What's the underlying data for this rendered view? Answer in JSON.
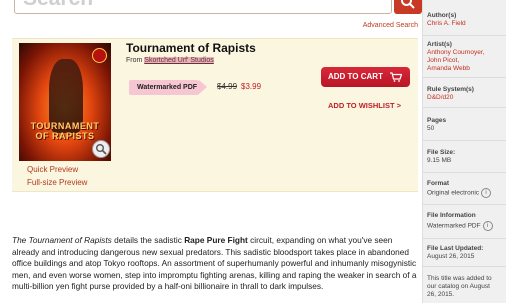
{
  "search": {
    "placeholder": "Search",
    "advanced_link": "Advanced Search"
  },
  "product": {
    "title": "Tournament of Rapists",
    "from_label": "From",
    "publisher": "Skortched Urf' Studios",
    "cover_title": "TOURNAMENT OF RAPISTS",
    "format_badge": "Watermarked PDF",
    "old_price": "$4.99",
    "price": "$3.99",
    "add_to_cart": "ADD TO CART",
    "add_to_wishlist": "ADD TO WISHLIST >",
    "quick_preview": "Quick Preview",
    "fullsize_preview": "Full-size Preview"
  },
  "description": {
    "title_italic": "The Tournament of Rapists",
    "text1": " details the sadistic ",
    "bold": "Rape Pure Fight",
    "text2": " circuit, expanding on what you've seen already and introducing dangerous new sexual predators. This sadistic bloodsport takes place in abandoned office buildings and atop Tokyo rooftops. An assortment of superhumanly powerful and inhumanly misogynistic men, and even worse women, step into impromptu fighting arenas, killing and raping the weaker in search of a multi-billion yen fight purse provided by a half-oni billionaire in thrall to dark impulses."
  },
  "sidebar": {
    "authors_label": "Author(s)",
    "authors": [
      "Chris A. Field"
    ],
    "artists_label": "Artist(s)",
    "artists": [
      "Anthony Cournoyer,",
      "John Picot,",
      "Amanda Webb"
    ],
    "rule_system_label": "Rule System(s)",
    "rule_system": "D&D/d20",
    "pages_label": "Pages",
    "pages": "50",
    "file_size_label": "File Size:",
    "file_size": "9.15 MB",
    "format_label": "Format",
    "format": "Original electronic",
    "file_info_label": "File Information",
    "file_info": "Watermarked PDF",
    "last_updated_label": "File Last Updated:",
    "last_updated": "August 26, 2015",
    "added_note": [
      "This title was added to",
      "our catalog on August",
      "26, 2015."
    ]
  },
  "colors": {
    "accent_red": "#c0202a",
    "badge_pink": "#f7c6d3",
    "panel": "#fbf6df"
  }
}
